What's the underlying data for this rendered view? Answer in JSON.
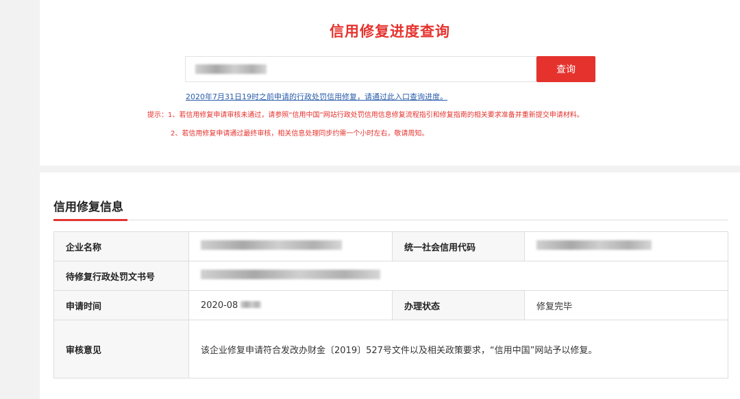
{
  "page": {
    "title": "信用修复进度查询",
    "search_button": "查询",
    "notice_link": "2020年7月31日19时之前申请的行政处罚信用修复，请通过此入口查询进度。",
    "tip_1": "提示：1、若信用修复申请审核未通过，请参照“信用中国”网站行政处罚信用信息修复流程指引和修复指南的相关要求准备并重新提交申请材料。",
    "tip_2": "2、若信用修复申请通过最终审核，相关信息处理同步约需一个小时左右，敬请周知。"
  },
  "info": {
    "section_title": "信用修复信息",
    "labels": {
      "company_name": "企业名称",
      "credit_code": "统一社会信用代码",
      "doc_number": "待修复行政处罚文书号",
      "apply_time": "申请时间",
      "status": "办理状态",
      "review": "审核意见"
    },
    "values": {
      "apply_time": "2020-08",
      "status": "修复完毕",
      "review": "该企业修复申请符合发改办财金〔2019〕527号文件以及相关政策要求，“信用中国”网站予以修复。"
    }
  },
  "colors": {
    "accent": "#e5322d",
    "link": "#2a5caa"
  }
}
